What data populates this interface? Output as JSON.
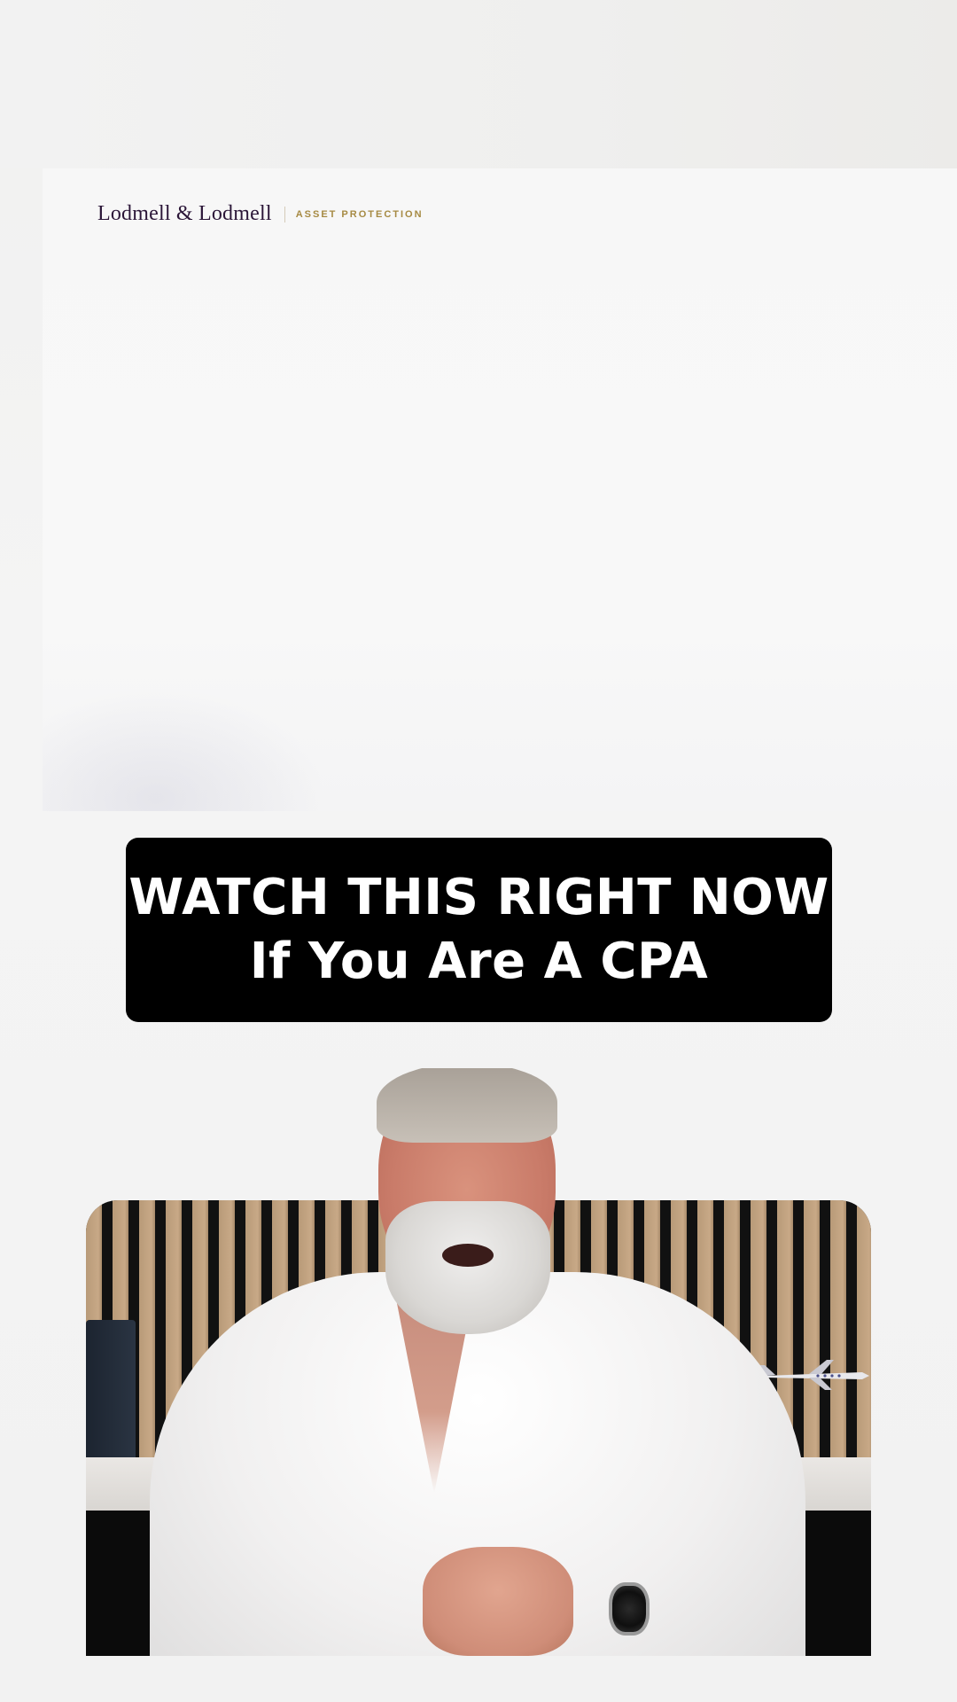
{
  "header": {
    "brand_name": "Lodmell & Lodmell",
    "brand_sub": "ASSET PROTECTION"
  },
  "caption": {
    "line1": "WATCH THIS RIGHT NOW",
    "line2": "If You Are A CPA"
  },
  "video": {
    "subject": "presenter-video"
  },
  "colors": {
    "brand_name": "#2b1638",
    "brand_sub": "#a68a43",
    "caption_bg": "#000000",
    "caption_text": "#ffffff"
  }
}
